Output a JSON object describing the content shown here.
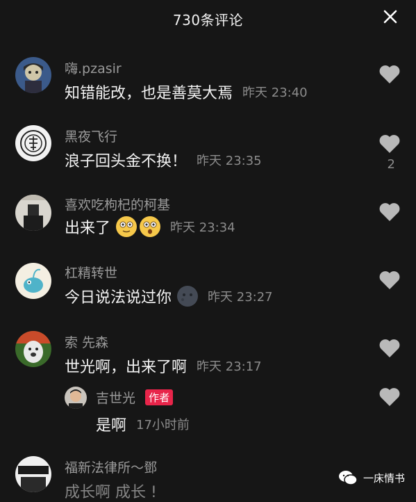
{
  "header": {
    "title": "730条评论",
    "close_icon": "close-icon"
  },
  "comments": [
    {
      "username": "嗨.pzasir",
      "text": "知错能改，也是善莫大焉",
      "time": "昨天 23:40",
      "likes": ""
    },
    {
      "username": "黑夜飞行",
      "text": "浪子回头金不换！",
      "time": "昨天 23:35",
      "likes": "2"
    },
    {
      "username": "喜欢吃枸杞的柯基",
      "text": "出来了",
      "time": "昨天 23:34",
      "likes": ""
    },
    {
      "username": "杠精转世",
      "text": "今日说法说过你",
      "time": "昨天 23:27",
      "likes": ""
    },
    {
      "username": "索 先森",
      "text": "世光啊，出来了啊",
      "time": "昨天 23:17",
      "likes": ""
    },
    {
      "username": "福新法律所～鄧",
      "text": "成长啊 成长 !",
      "time": "",
      "likes": ""
    }
  ],
  "reply": {
    "username": "吉世光",
    "badge": "作者",
    "text": "是啊",
    "time": "17小时前"
  },
  "watermark": {
    "text": "一床情书"
  },
  "colors": {
    "background": "#161616",
    "badge": "#e8254a",
    "name": "#9a9a9a",
    "time": "#8c8c8c"
  }
}
